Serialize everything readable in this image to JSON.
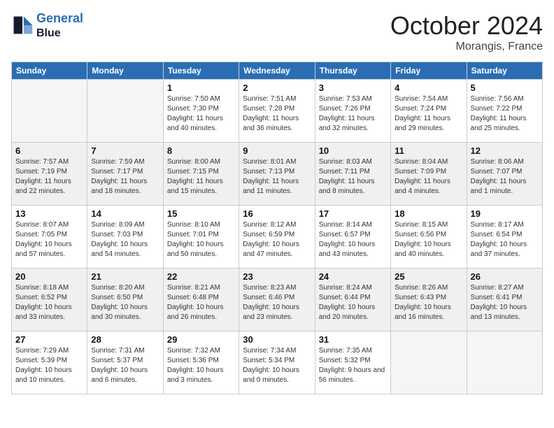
{
  "header": {
    "logo_line1": "General",
    "logo_line2": "Blue",
    "month": "October 2024",
    "location": "Morangis, France"
  },
  "weekdays": [
    "Sunday",
    "Monday",
    "Tuesday",
    "Wednesday",
    "Thursday",
    "Friday",
    "Saturday"
  ],
  "weeks": [
    [
      {
        "day": "",
        "empty": true
      },
      {
        "day": "",
        "empty": true
      },
      {
        "day": "1",
        "sunrise": "Sunrise: 7:50 AM",
        "sunset": "Sunset: 7:30 PM",
        "daylight": "Daylight: 11 hours and 40 minutes."
      },
      {
        "day": "2",
        "sunrise": "Sunrise: 7:51 AM",
        "sunset": "Sunset: 7:28 PM",
        "daylight": "Daylight: 11 hours and 36 minutes."
      },
      {
        "day": "3",
        "sunrise": "Sunrise: 7:53 AM",
        "sunset": "Sunset: 7:26 PM",
        "daylight": "Daylight: 11 hours and 32 minutes."
      },
      {
        "day": "4",
        "sunrise": "Sunrise: 7:54 AM",
        "sunset": "Sunset: 7:24 PM",
        "daylight": "Daylight: 11 hours and 29 minutes."
      },
      {
        "day": "5",
        "sunrise": "Sunrise: 7:56 AM",
        "sunset": "Sunset: 7:22 PM",
        "daylight": "Daylight: 11 hours and 25 minutes."
      }
    ],
    [
      {
        "day": "6",
        "sunrise": "Sunrise: 7:57 AM",
        "sunset": "Sunset: 7:19 PM",
        "daylight": "Daylight: 11 hours and 22 minutes."
      },
      {
        "day": "7",
        "sunrise": "Sunrise: 7:59 AM",
        "sunset": "Sunset: 7:17 PM",
        "daylight": "Daylight: 11 hours and 18 minutes."
      },
      {
        "day": "8",
        "sunrise": "Sunrise: 8:00 AM",
        "sunset": "Sunset: 7:15 PM",
        "daylight": "Daylight: 11 hours and 15 minutes."
      },
      {
        "day": "9",
        "sunrise": "Sunrise: 8:01 AM",
        "sunset": "Sunset: 7:13 PM",
        "daylight": "Daylight: 11 hours and 11 minutes."
      },
      {
        "day": "10",
        "sunrise": "Sunrise: 8:03 AM",
        "sunset": "Sunset: 7:11 PM",
        "daylight": "Daylight: 11 hours and 8 minutes."
      },
      {
        "day": "11",
        "sunrise": "Sunrise: 8:04 AM",
        "sunset": "Sunset: 7:09 PM",
        "daylight": "Daylight: 11 hours and 4 minutes."
      },
      {
        "day": "12",
        "sunrise": "Sunrise: 8:06 AM",
        "sunset": "Sunset: 7:07 PM",
        "daylight": "Daylight: 11 hours and 1 minute."
      }
    ],
    [
      {
        "day": "13",
        "sunrise": "Sunrise: 8:07 AM",
        "sunset": "Sunset: 7:05 PM",
        "daylight": "Daylight: 10 hours and 57 minutes."
      },
      {
        "day": "14",
        "sunrise": "Sunrise: 8:09 AM",
        "sunset": "Sunset: 7:03 PM",
        "daylight": "Daylight: 10 hours and 54 minutes."
      },
      {
        "day": "15",
        "sunrise": "Sunrise: 8:10 AM",
        "sunset": "Sunset: 7:01 PM",
        "daylight": "Daylight: 10 hours and 50 minutes."
      },
      {
        "day": "16",
        "sunrise": "Sunrise: 8:12 AM",
        "sunset": "Sunset: 6:59 PM",
        "daylight": "Daylight: 10 hours and 47 minutes."
      },
      {
        "day": "17",
        "sunrise": "Sunrise: 8:14 AM",
        "sunset": "Sunset: 6:57 PM",
        "daylight": "Daylight: 10 hours and 43 minutes."
      },
      {
        "day": "18",
        "sunrise": "Sunrise: 8:15 AM",
        "sunset": "Sunset: 6:56 PM",
        "daylight": "Daylight: 10 hours and 40 minutes."
      },
      {
        "day": "19",
        "sunrise": "Sunrise: 8:17 AM",
        "sunset": "Sunset: 6:54 PM",
        "daylight": "Daylight: 10 hours and 37 minutes."
      }
    ],
    [
      {
        "day": "20",
        "sunrise": "Sunrise: 8:18 AM",
        "sunset": "Sunset: 6:52 PM",
        "daylight": "Daylight: 10 hours and 33 minutes."
      },
      {
        "day": "21",
        "sunrise": "Sunrise: 8:20 AM",
        "sunset": "Sunset: 6:50 PM",
        "daylight": "Daylight: 10 hours and 30 minutes."
      },
      {
        "day": "22",
        "sunrise": "Sunrise: 8:21 AM",
        "sunset": "Sunset: 6:48 PM",
        "daylight": "Daylight: 10 hours and 26 minutes."
      },
      {
        "day": "23",
        "sunrise": "Sunrise: 8:23 AM",
        "sunset": "Sunset: 6:46 PM",
        "daylight": "Daylight: 10 hours and 23 minutes."
      },
      {
        "day": "24",
        "sunrise": "Sunrise: 8:24 AM",
        "sunset": "Sunset: 6:44 PM",
        "daylight": "Daylight: 10 hours and 20 minutes."
      },
      {
        "day": "25",
        "sunrise": "Sunrise: 8:26 AM",
        "sunset": "Sunset: 6:43 PM",
        "daylight": "Daylight: 10 hours and 16 minutes."
      },
      {
        "day": "26",
        "sunrise": "Sunrise: 8:27 AM",
        "sunset": "Sunset: 6:41 PM",
        "daylight": "Daylight: 10 hours and 13 minutes."
      }
    ],
    [
      {
        "day": "27",
        "sunrise": "Sunrise: 7:29 AM",
        "sunset": "Sunset: 5:39 PM",
        "daylight": "Daylight: 10 hours and 10 minutes."
      },
      {
        "day": "28",
        "sunrise": "Sunrise: 7:31 AM",
        "sunset": "Sunset: 5:37 PM",
        "daylight": "Daylight: 10 hours and 6 minutes."
      },
      {
        "day": "29",
        "sunrise": "Sunrise: 7:32 AM",
        "sunset": "Sunset: 5:36 PM",
        "daylight": "Daylight: 10 hours and 3 minutes."
      },
      {
        "day": "30",
        "sunrise": "Sunrise: 7:34 AM",
        "sunset": "Sunset: 5:34 PM",
        "daylight": "Daylight: 10 hours and 0 minutes."
      },
      {
        "day": "31",
        "sunrise": "Sunrise: 7:35 AM",
        "sunset": "Sunset: 5:32 PM",
        "daylight": "Daylight: 9 hours and 56 minutes."
      },
      {
        "day": "",
        "empty": true
      },
      {
        "day": "",
        "empty": true
      }
    ]
  ]
}
